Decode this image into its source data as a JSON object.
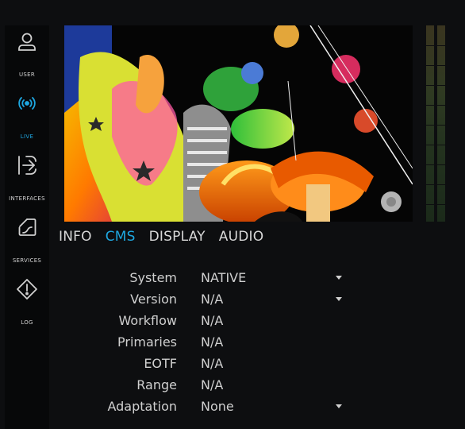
{
  "sidebar": {
    "items": [
      {
        "label": "USER",
        "icon": "user-icon",
        "active": false
      },
      {
        "label": "LIVE",
        "icon": "live-broadcast-icon",
        "active": true
      },
      {
        "label": "INTERFACES",
        "icon": "interfaces-icon",
        "active": false
      },
      {
        "label": "SERVICES",
        "icon": "services-icon",
        "active": false
      },
      {
        "label": "LOG",
        "icon": "warning-icon",
        "active": false
      }
    ]
  },
  "tabs": [
    {
      "label": "INFO",
      "active": false
    },
    {
      "label": "CMS",
      "active": true
    },
    {
      "label": "DISPLAY",
      "active": false
    },
    {
      "label": "AUDIO",
      "active": false
    }
  ],
  "cms": {
    "system": {
      "label": "System",
      "value": "NATIVE"
    },
    "version": {
      "label": "Version",
      "value": "N/A"
    },
    "workflow": {
      "label": "Workflow",
      "value": "N/A"
    },
    "primaries": {
      "label": "Primaries",
      "value": "N/A"
    },
    "eotf": {
      "label": "EOTF",
      "value": "N/A"
    },
    "range": {
      "label": "Range",
      "value": "N/A"
    },
    "adaptation": {
      "label": "Adaptation",
      "value": "None"
    }
  },
  "colors": {
    "accent": "#1ea7e0",
    "background": "#0d0e10",
    "text": "#d8d8d8"
  }
}
